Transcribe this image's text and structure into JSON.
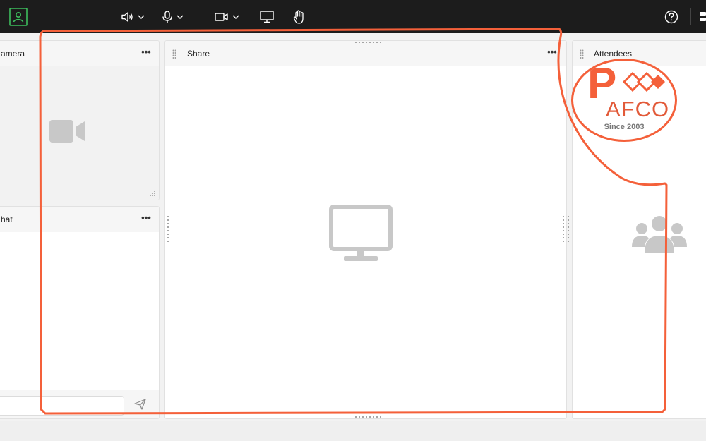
{
  "toolbar": {
    "buttons": [
      {
        "name": "profile",
        "icon": "user-icon"
      },
      {
        "name": "audio",
        "icon": "speaker-icon",
        "has_dropdown": true
      },
      {
        "name": "microphone",
        "icon": "microphone-icon",
        "has_dropdown": true
      },
      {
        "name": "video",
        "icon": "camera-icon",
        "has_dropdown": true
      },
      {
        "name": "share-screen",
        "icon": "monitor-icon"
      },
      {
        "name": "raise-hand",
        "icon": "hand-icon"
      },
      {
        "name": "help",
        "icon": "help-icon"
      }
    ],
    "accent_color": "#3dbd5d"
  },
  "panels": {
    "camera": {
      "title": "amera",
      "menu": "•••",
      "icon": "video-camera-icon"
    },
    "chat": {
      "title": "hat",
      "menu": "•••",
      "send_icon": "send-icon",
      "input_value": ""
    },
    "share": {
      "title": "Share",
      "menu": "•••",
      "icon": "monitor-icon"
    },
    "attendees": {
      "title": "Attendees",
      "icon": "people-group-icon"
    }
  },
  "logo": {
    "letter": "P",
    "name": "AFCO",
    "tagline": "Since 2003",
    "color": "#f4603a"
  },
  "annotation": {
    "color": "#f4603a"
  }
}
